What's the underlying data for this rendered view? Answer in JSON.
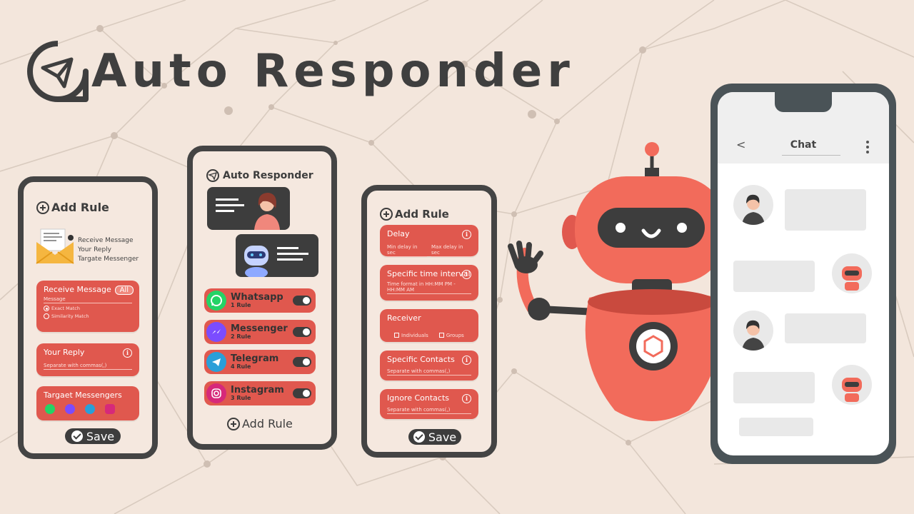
{
  "title": "Auto Responder",
  "colors": {
    "background": "#f3e6dc",
    "accent": "#e0584e",
    "dark": "#3d3d3d",
    "robot": "#f26b5b"
  },
  "phone1": {
    "header": "Add Rule",
    "intro_lines": [
      "Receive Message",
      "Your Reply",
      "Targate Messenger"
    ],
    "receive": {
      "title": "Receive Message",
      "badge": "All",
      "field": "Message",
      "options": [
        "Exact Match",
        "Similarity Match"
      ],
      "selected": "Exact Match"
    },
    "reply": {
      "title": "Your Reply",
      "placeholder": "Separate with commas(,)"
    },
    "targets": {
      "title": "Targaet Messengers",
      "icons": [
        "whatsapp-icon",
        "messenger-icon",
        "telegram-icon",
        "instagram-icon"
      ]
    },
    "save": "Save"
  },
  "phone2": {
    "header": "Auto Responder",
    "apps": [
      {
        "name": "Whatsapp",
        "rules": "1 Rule",
        "icon": "whatsapp-icon",
        "color": "#25d366",
        "enabled": true
      },
      {
        "name": "Messenger",
        "rules": "2 Rule",
        "icon": "messenger-icon",
        "color": "#7b4cff",
        "enabled": true
      },
      {
        "name": "Telegram",
        "rules": "4 Rule",
        "icon": "telegram-icon",
        "color": "#2a9fd8",
        "enabled": true
      },
      {
        "name": "Instagram",
        "rules": "3 Rule",
        "icon": "instagram-icon",
        "color": "#d6297a",
        "enabled": true
      }
    ],
    "add_rule": "Add Rule"
  },
  "phone3": {
    "header": "Add Rule",
    "delay": {
      "title": "Delay",
      "min": "Min delay in sec",
      "max": "Max delay in sec"
    },
    "interval": {
      "title": "Specific time interval",
      "hint": "Time format in HH:MM PM - HH:MM AM"
    },
    "receiver": {
      "title": "Receiver",
      "options": [
        "Individuals",
        "Groups"
      ]
    },
    "contacts": {
      "title": "Specific Contacts",
      "placeholder": "Separate with commas(,)"
    },
    "ignore": {
      "title": "Ignore Contacts",
      "placeholder": "Separate with commas(,)"
    },
    "save": "Save"
  },
  "chat": {
    "back": "<",
    "title": "Chat"
  }
}
